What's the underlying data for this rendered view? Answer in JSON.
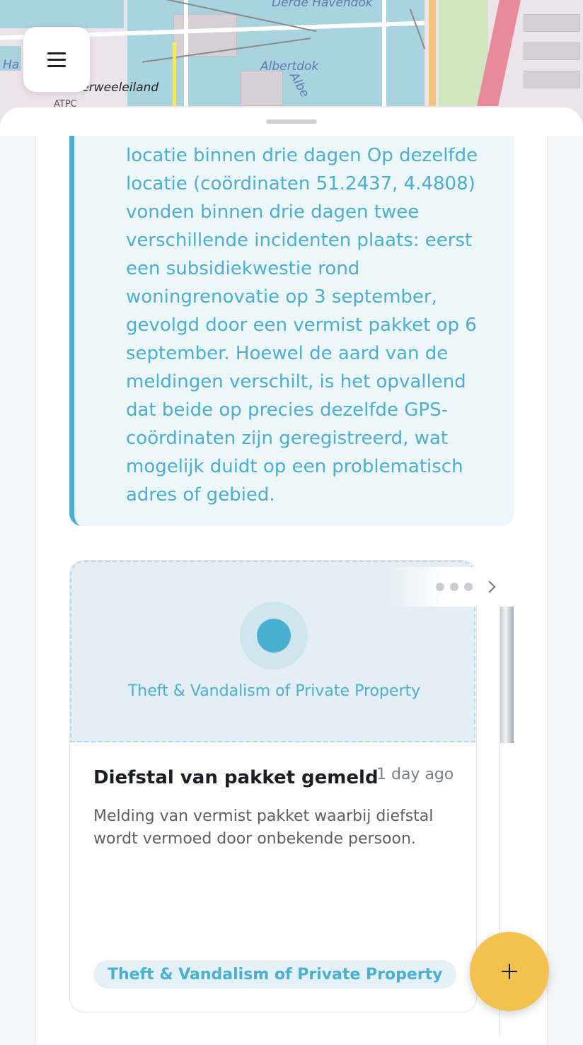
{
  "map": {
    "labels": {
      "derde_havendok": "Derde Havendok",
      "albertdok": "Albertdok",
      "albert": "Albe",
      "oosterweeleiland": "Oosterweeleiland",
      "ha": "Ha",
      "atpc": "ATPC"
    }
  },
  "menu": {
    "icon": "hamburger-menu-icon"
  },
  "quote": {
    "lines": [
      "locatie binnen drie dagen Op dezelfde",
      "locatie (coördinaten 51.2437, 4.4808)",
      "vonden binnen drie dagen twee",
      "verschillende incidenten plaats: eerst",
      "een subsidiekwestie rond",
      "woningrenovatie op 3 september,",
      "gevolgd door een vermist pakket op 6",
      "september. Hoewel de aard van de",
      "meldingen verschilt, is het opvallend",
      "dat beide op precies dezelfde GPS-",
      "coördinaten zijn geregistreerd, wat",
      "mogelijk duidt op een problematisch",
      "adres of gebied."
    ]
  },
  "card": {
    "media_label": "Theft & Vandalism of Private Property",
    "title": "Diefstal van pakket gemeld",
    "time": "1 day ago",
    "description_lines": [
      "Melding van vermist pakket waarbij diefstal",
      "wordt vermoed door onbekende persoon."
    ],
    "chip": "Theft & Vandalism of Private Property"
  },
  "pager": {
    "icons": [
      "more-dots-icon",
      "chevron-right-icon"
    ]
  },
  "fab": {
    "icon": "plus-icon"
  },
  "colors": {
    "accent": "#4aafd0",
    "fab": "#f2c14e",
    "quote_bg": "#edf6f9"
  }
}
